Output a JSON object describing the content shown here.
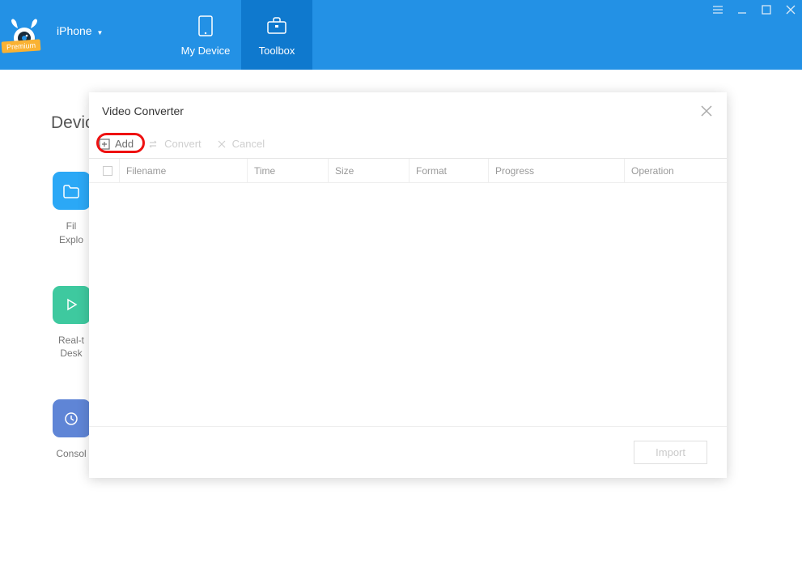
{
  "header": {
    "device_name": "iPhone",
    "premium_label": "Premium",
    "tabs": [
      {
        "label": "My Device"
      },
      {
        "label": "Toolbox"
      }
    ]
  },
  "background": {
    "section_title": "Devic",
    "items": [
      {
        "label": "File\nExplo",
        "color": "#2ba8f6"
      },
      {
        "label": "Real-t\nDesk",
        "color": "#3ec99f"
      },
      {
        "label": "Consol",
        "color": "#5f85d6"
      }
    ]
  },
  "modal": {
    "title": "Video Converter",
    "toolbar": {
      "add_label": "Add",
      "convert_label": "Convert",
      "cancel_label": "Cancel"
    },
    "columns": {
      "filename": "Filename",
      "time": "Time",
      "size": "Size",
      "format": "Format",
      "progress": "Progress",
      "operation": "Operation"
    },
    "footer": {
      "import_label": "Import"
    }
  }
}
